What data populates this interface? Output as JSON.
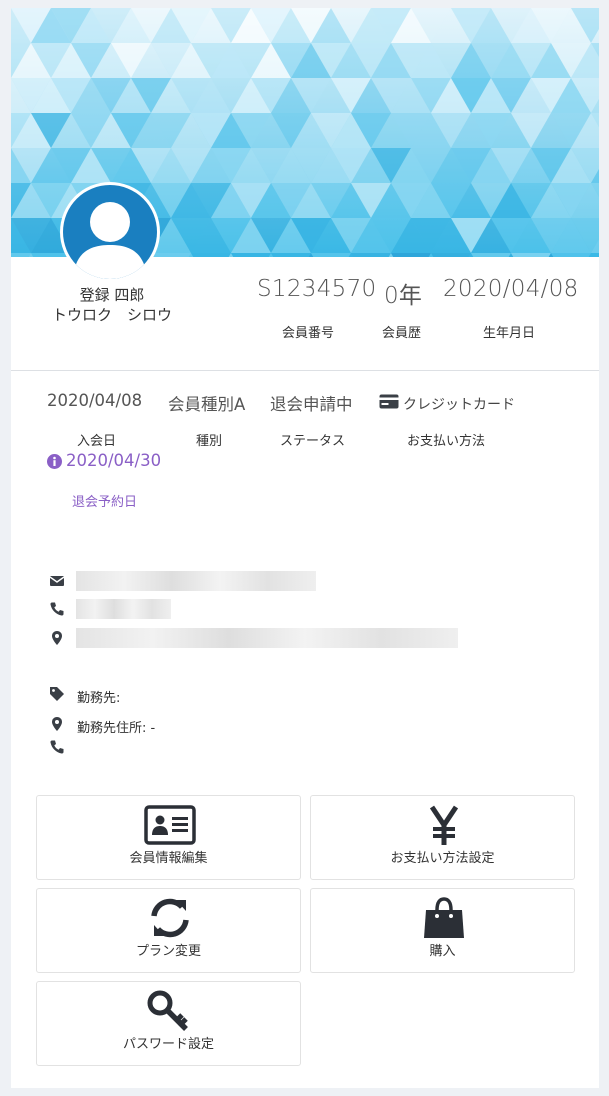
{
  "profile": {
    "name_kanji": "登録 四郎",
    "name_kana": "トウロク　シロウ",
    "member_number": "S1234570",
    "member_years": "0年",
    "birthdate": "2020/04/08",
    "member_number_label": "会員番号",
    "member_years_label": "会員歴",
    "birthdate_label": "生年月日"
  },
  "membership": {
    "join_date": "2020/04/08",
    "type": "会員種別A",
    "status": "退会申請中",
    "payment_method": "クレジットカード",
    "join_date_label": "入会日",
    "type_label": "種別",
    "status_label": "ステータス",
    "payment_label": "お支払い方法",
    "withdrawal_date": "2020/04/30",
    "withdrawal_label": "退会予約日"
  },
  "work": {
    "employer_label": "勤務先:",
    "address_label": "勤務先住所: -"
  },
  "actions": {
    "edit_info": "会員情報編集",
    "payment_settings": "お支払い方法設定",
    "plan_change": "プラン変更",
    "purchase": "購入",
    "password": "パスワード設定"
  },
  "colors": {
    "accent_purple": "#8a5fc6",
    "avatar_blue": "#1a7fc0",
    "icon_dark": "#2b2f36"
  }
}
